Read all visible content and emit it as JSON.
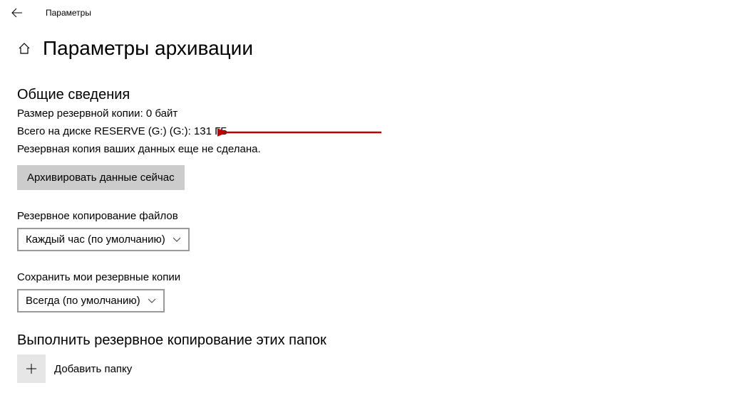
{
  "topbar": {
    "title": "Параметры"
  },
  "page": {
    "title": "Параметры архивации"
  },
  "overview": {
    "heading": "Общие сведения",
    "backup_size": "Размер резервной копии: 0 байт",
    "disk_total": "Всего на диске RESERVE (G:) (G:): 131 ГБ",
    "not_backed_up": "Резервная копия ваших данных еще не сделана.",
    "backup_now_button": "Архивировать данные сейчас"
  },
  "backup_files": {
    "label": "Резервное копирование файлов",
    "selected": "Каждый час (по умолчанию)"
  },
  "keep_backups": {
    "label": "Сохранить мои резервные копии",
    "selected": "Всегда (по умолчанию)"
  },
  "folders": {
    "heading": "Выполнить резервное копирование этих папок",
    "add_label": "Добавить папку"
  }
}
